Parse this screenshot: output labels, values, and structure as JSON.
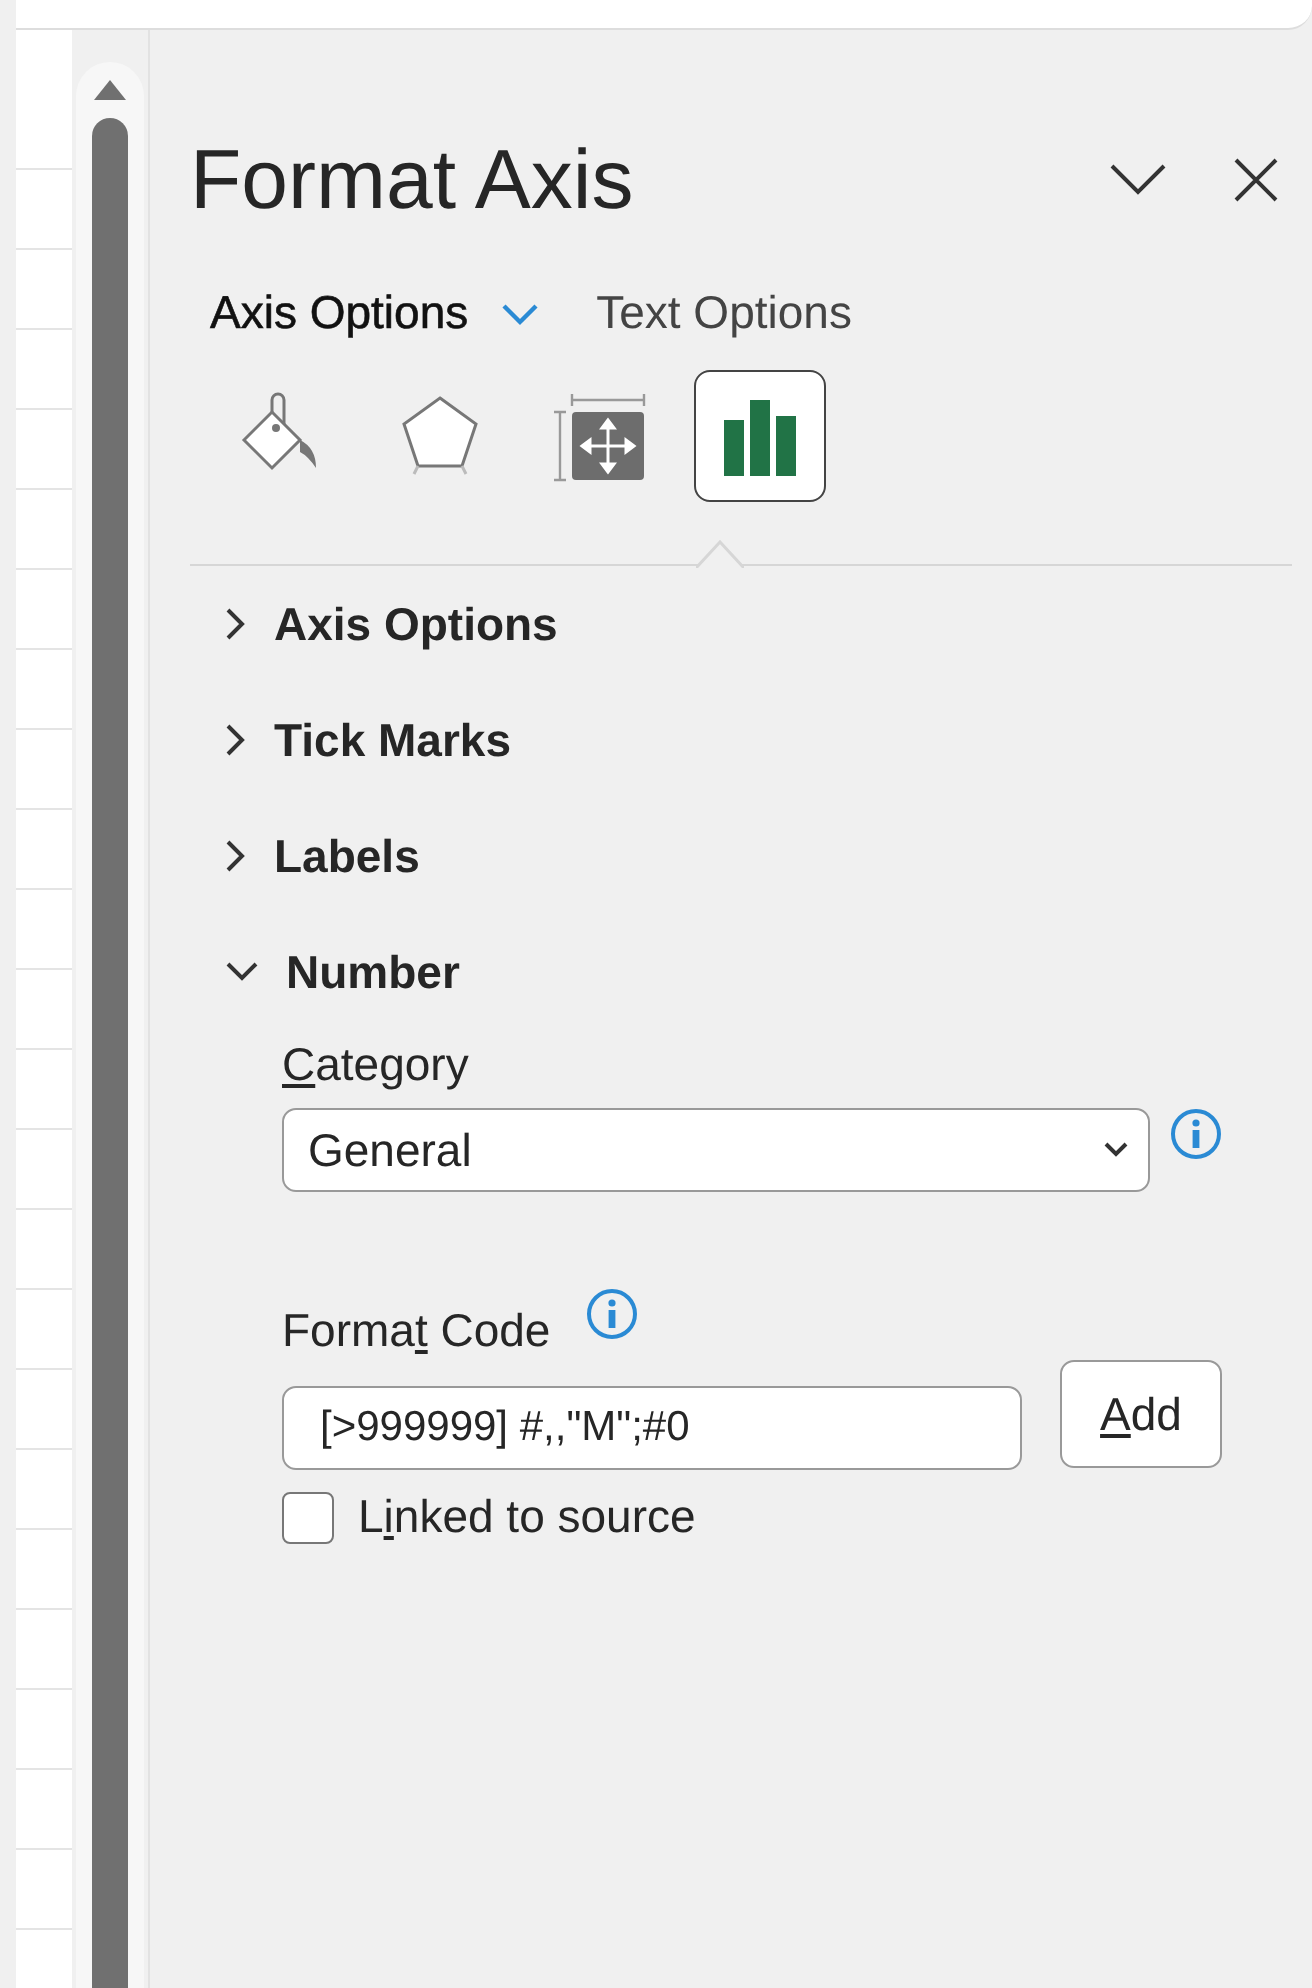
{
  "pane": {
    "title": "Format Axis"
  },
  "option_tabs": [
    {
      "label": "Axis Options",
      "selected": true
    },
    {
      "label": "Text Options",
      "selected": false
    }
  ],
  "icon_tabs": [
    {
      "kind": "fill",
      "selected": false
    },
    {
      "kind": "effects",
      "selected": false
    },
    {
      "kind": "size",
      "selected": false
    },
    {
      "kind": "options",
      "selected": true
    }
  ],
  "sections": [
    {
      "title": "Axis Options",
      "expanded": false
    },
    {
      "title": "Tick Marks",
      "expanded": false
    },
    {
      "title": "Labels",
      "expanded": false
    },
    {
      "title": "Number",
      "expanded": true
    }
  ],
  "number": {
    "category": {
      "label": {
        "key": "C",
        "post": "ategory"
      },
      "value": "General"
    },
    "format_code": {
      "label": {
        "pre": "Forma",
        "key": "t",
        "post": " Code"
      },
      "value": "[>999999] #,,\"M\";#0"
    },
    "add_button": {
      "key": "A",
      "post": "dd"
    },
    "linked_to_source": {
      "label": {
        "pre": "L",
        "key": "i",
        "post": "nked to source"
      },
      "checked": false
    }
  }
}
